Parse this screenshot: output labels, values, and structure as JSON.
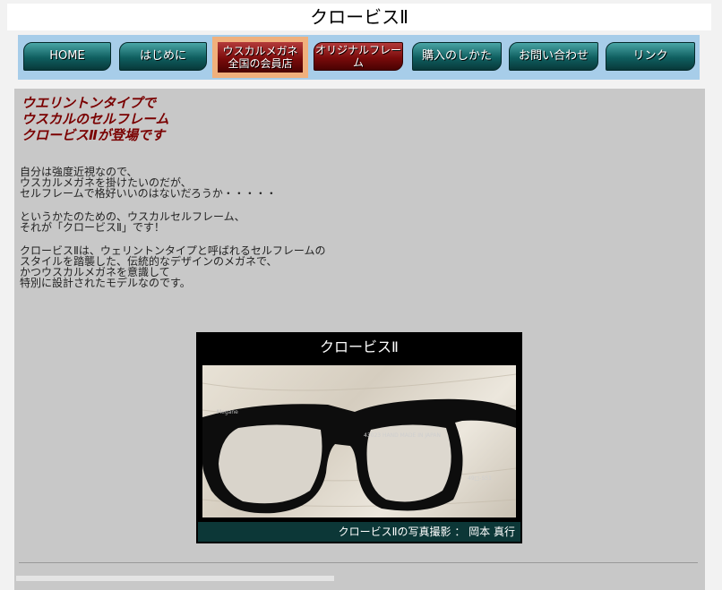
{
  "header": {
    "title": "クロービスⅡ"
  },
  "nav": {
    "items": [
      {
        "label": "HOME"
      },
      {
        "label": "はじめに"
      },
      {
        "label": "ウスカルメガネ\n全国の会員店"
      },
      {
        "label": "オリジナルフレーム"
      },
      {
        "label": "購入のしかた"
      },
      {
        "label": "お問い合わせ"
      },
      {
        "label": "リンク"
      }
    ],
    "active_color": "#f0b07c",
    "accent_teal": "#0f5f60",
    "accent_red": "#7a0b0b"
  },
  "main": {
    "headline": [
      "ウエリントンタイプで",
      "ウスカルのセルフレーム",
      "クロービスⅡが登場です"
    ],
    "paragraphs": [
      [
        "自分は強度近視なので、",
        "ウスカルメガネを掛けたいのだが、",
        "セルフレームで格好いいのはないだろうか・・・・・"
      ],
      [
        "というかたのための、ウスカルセルフレーム、",
        "それが「クロービスⅡ」です！"
      ],
      [
        "クロービスⅡは、ウェリントンタイプと呼ばれるセルフレームの",
        "スタイルを踏襲した、伝統的なデザインのメガネで、",
        "かつウスカルメガネを意識して",
        "特別に設計されたモデルなのです。"
      ]
    ]
  },
  "photo": {
    "title": "クロービスⅡ",
    "caption": "クロービスⅡの写真撮影 ： 岡本 真行",
    "frame_text": "43023  HAND MADE IN JAPAN",
    "frame_side_text": "Megane",
    "frame_size_text": "49□-SS1"
  }
}
